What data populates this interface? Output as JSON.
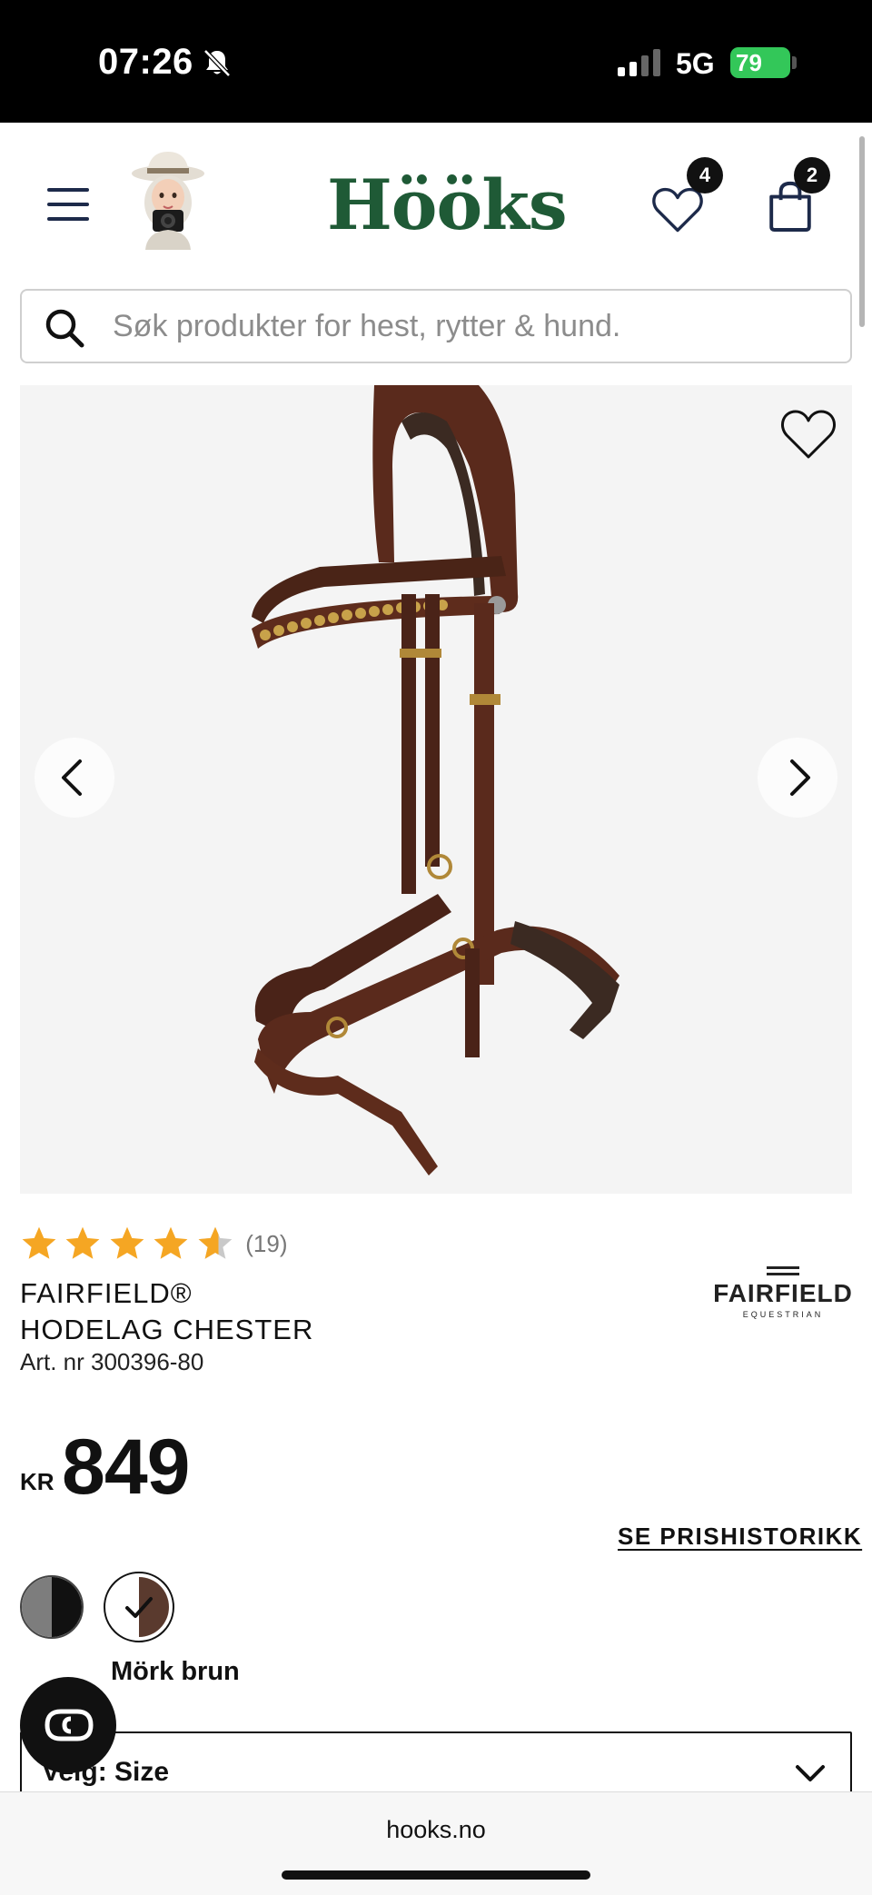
{
  "status_bar": {
    "time": "07:26",
    "network": "5G",
    "battery": "79"
  },
  "header": {
    "logo": "Hööks",
    "wishlist_count": "4",
    "cart_count": "2"
  },
  "search": {
    "placeholder": "Søk produkter for hest, rytter & hund."
  },
  "product": {
    "rating_value": 4.5,
    "rating_max": 5,
    "review_count": "(19)",
    "name_line1": "FAIRFIELD®",
    "name_line2": "HODELAG CHESTER",
    "art_nr": "Art. nr 300396-80",
    "brand": "FAIRFIELD",
    "brand_sub": "EQUESTRIAN",
    "currency": "KR",
    "price": "849",
    "price_history_link": "SE PRISHISTORIKK",
    "selected_color": "Mörk brun",
    "size_select_label": "Velg: Size"
  },
  "colors": {
    "brand_green": "#1f5a36",
    "star": "#f5a623",
    "leather": "#5a2a1c"
  },
  "browser": {
    "url": "hooks.no"
  }
}
